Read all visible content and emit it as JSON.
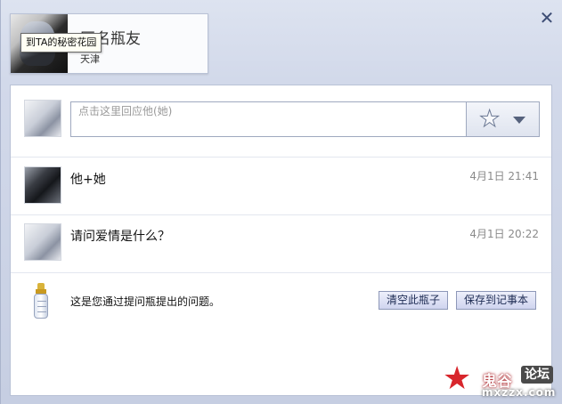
{
  "window": {
    "close_icon": "close-icon"
  },
  "profile": {
    "name": "匿名瓶友",
    "city": "天津",
    "tooltip": "到TA的秘密花园"
  },
  "reply": {
    "placeholder": "点击这里回应他(她)",
    "emoticon_icon": "magic-wand-star-icon"
  },
  "messages": [
    {
      "text": "他+她",
      "time": "4月1日 21:41"
    },
    {
      "text": "请问爱情是什么？",
      "time": "4月1日 20:22"
    }
  ],
  "footer": {
    "note": "这是您通过提问瓶提出的问题。",
    "clear_button": "清空此瓶子",
    "save_button": "保存到记事本"
  },
  "watermark": {
    "title": "鬼谷",
    "badge": "论坛",
    "url": "mxzzx.com"
  }
}
